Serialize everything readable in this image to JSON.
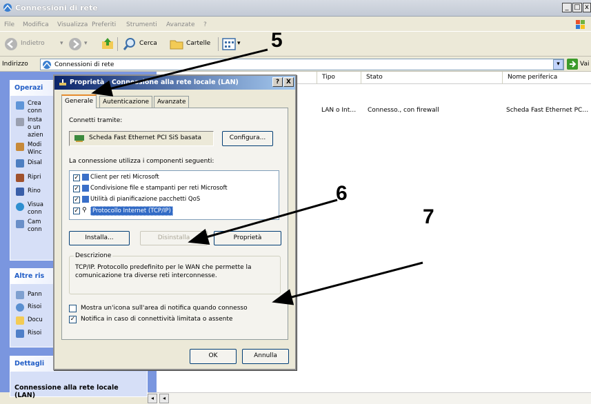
{
  "window": {
    "title": "Connessioni di rete"
  },
  "menu": [
    "File",
    "Modifica",
    "Visualizza",
    "Preferiti",
    "Strumenti",
    "Avanzate",
    "?"
  ],
  "toolbar": {
    "back": "Indietro",
    "search": "Cerca",
    "folders": "Cartelle"
  },
  "address": {
    "label": "Indirizzo",
    "value": "Connessioni di rete",
    "go": "Vai"
  },
  "left_pane": {
    "tasks_title": "Operazi",
    "tasks": [
      "Crea\nconn",
      "Insta\no un\nazien",
      "Modi\nWinc",
      "Disal",
      "Ripri",
      "Rino",
      "Visua\nconn",
      "Cam\nconn"
    ],
    "other_title": "Altre ris",
    "other": [
      "Pann",
      "Risoi",
      "Docu",
      "Risoi"
    ],
    "details_title": "Dettagli",
    "details_name": "Connessione alla rete locale (LAN)"
  },
  "columns": {
    "tipo": "Tipo",
    "stato": "Stato",
    "nome": "Nome periferica"
  },
  "row": {
    "tipo": "LAN o Int…",
    "stato": "Connesso., con firewall",
    "nome": "Scheda Fast Ethernet PC…"
  },
  "dialog": {
    "title": "Proprietà - Connessione alla rete locale (LAN)",
    "help": "?",
    "close": "X",
    "tabs": [
      "Generale",
      "Autenticazione",
      "Avanzate"
    ],
    "connect_label": "Connetti tramite:",
    "adapter": "Scheda Fast Ethernet PCI SiS basata",
    "configure": "Configura...",
    "components_label": "La connessione utilizza i componenti seguenti:",
    "components": [
      {
        "label": "Client per reti Microsoft",
        "checked": true
      },
      {
        "label": "Condivisione file e stampanti per reti Microsoft",
        "checked": true
      },
      {
        "label": "Utilità di pianificazione pacchetti QoS",
        "checked": true
      },
      {
        "label": "Protocollo Internet (TCP/IP)",
        "checked": true,
        "selected": true
      }
    ],
    "install": "Installa...",
    "uninstall": "Disinstalla",
    "properties": "Proprietà",
    "description_title": "Descrizione",
    "description": "TCP/IP. Protocollo predefinito per le WAN che permette la comunicazione tra diverse reti interconnesse.",
    "show_icon": {
      "label": "Mostra un'icona sull'area di notifica quando connesso",
      "checked": false
    },
    "notify": {
      "label": "Notifica in caso di connettività limitata o assente",
      "checked": true
    },
    "ok": "OK",
    "cancel": "Annulla"
  },
  "annotations": [
    "5",
    "6",
    "7"
  ],
  "colors": {
    "selection": "#316ac5",
    "title_active": "#0a246a",
    "left_pane": "#7a96df"
  }
}
